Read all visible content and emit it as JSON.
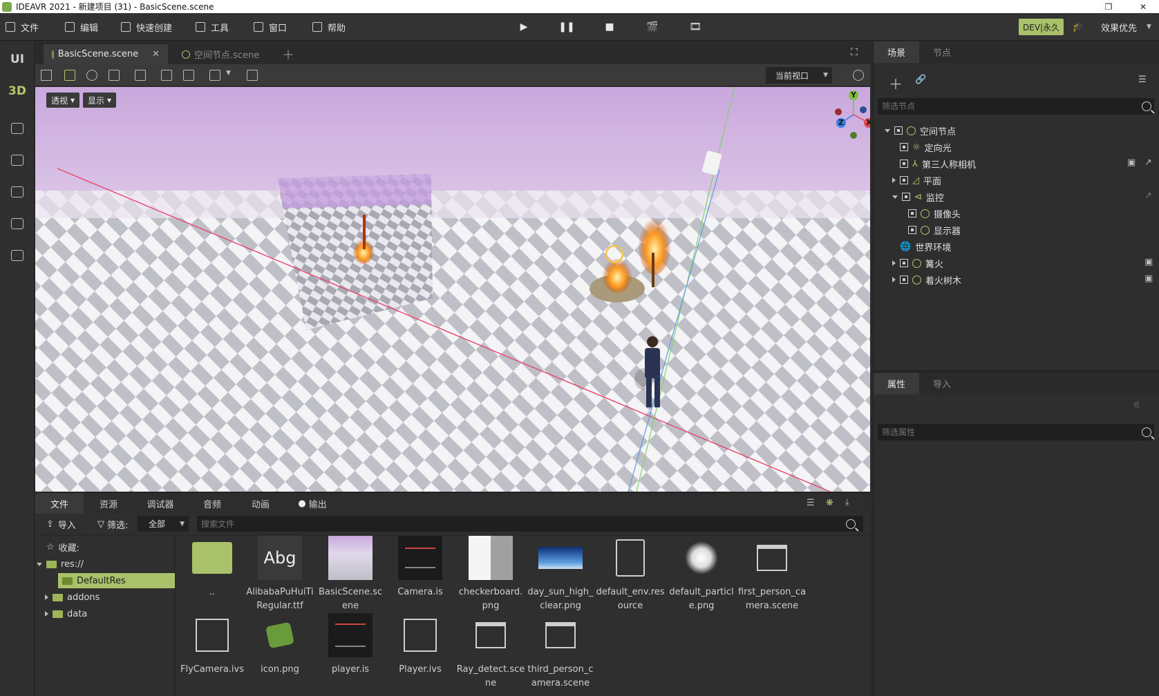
{
  "window": {
    "title": "IDEAVR 2021 - 新建项目 (31) - BasicScene.scene"
  },
  "menu": [
    {
      "label": "文件"
    },
    {
      "label": "编辑"
    },
    {
      "label": "快速创建"
    },
    {
      "label": "工具"
    },
    {
      "label": "窗口"
    },
    {
      "label": "帮助"
    }
  ],
  "topright": {
    "badge": "DEV|永久",
    "quality": "效果优先"
  },
  "rail": {
    "ui": "UI",
    "3d": "3D"
  },
  "editor_tabs": [
    {
      "label": "BasicScene.scene",
      "active": true
    },
    {
      "label": "空间节点.scene",
      "active": false
    }
  ],
  "viewport": {
    "view_select": "当前视口",
    "perspective_btn": "透视",
    "display_btn": "显示",
    "gizmo": {
      "x": "X",
      "y": "Y",
      "z": "Z"
    }
  },
  "bottom": {
    "tabs": [
      {
        "label": "文件",
        "active": true
      },
      {
        "label": "资源",
        "active": false
      },
      {
        "label": "调试器",
        "active": false
      },
      {
        "label": "音频",
        "active": false
      },
      {
        "label": "动画",
        "active": false
      },
      {
        "label": "输出",
        "active": false
      }
    ],
    "import_label": "导入",
    "filter_label": "筛选:",
    "filter_value": "全部",
    "search_placeholder": "搜索文件",
    "tree": [
      {
        "label": "收藏:"
      },
      {
        "label": "res://"
      },
      {
        "label": "DefaultRes"
      },
      {
        "label": "addons"
      },
      {
        "label": "data"
      }
    ],
    "files_row1": [
      {
        "name": ".."
      },
      {
        "name": "AlibabaPuHuiTiRegular.ttf",
        "thumb_text": "Abg"
      },
      {
        "name": "BasicScene.scene"
      },
      {
        "name": "Camera.is"
      },
      {
        "name": "checkerboard.png"
      },
      {
        "name": "day_sun_high_clear.png"
      },
      {
        "name": "default_env.resource"
      },
      {
        "name": "default_particle.png"
      },
      {
        "name": "first_person_camera.scene"
      }
    ],
    "files_row2": [
      {
        "name": "FlyCamera.ivs"
      },
      {
        "name": "icon.png"
      },
      {
        "name": "player.is"
      },
      {
        "name": "Player.ivs"
      },
      {
        "name": "Ray_detect.scene"
      },
      {
        "name": "third_person_camera.scene"
      }
    ]
  },
  "scene_panel": {
    "tabs": [
      {
        "label": "场景",
        "active": true
      },
      {
        "label": "节点",
        "active": false
      }
    ],
    "filter_placeholder": "筛选节点",
    "nodes": [
      {
        "label": "空间节点"
      },
      {
        "label": "定向光"
      },
      {
        "label": "第三人称相机"
      },
      {
        "label": "平面"
      },
      {
        "label": "监控"
      },
      {
        "label": "摄像头"
      },
      {
        "label": "显示器"
      },
      {
        "label": "世界环境"
      },
      {
        "label": "篝火"
      },
      {
        "label": "着火树木"
      }
    ]
  },
  "props_panel": {
    "tabs": [
      {
        "label": "属性",
        "active": true
      },
      {
        "label": "导入",
        "active": false
      }
    ],
    "filter_placeholder": "筛选属性"
  }
}
